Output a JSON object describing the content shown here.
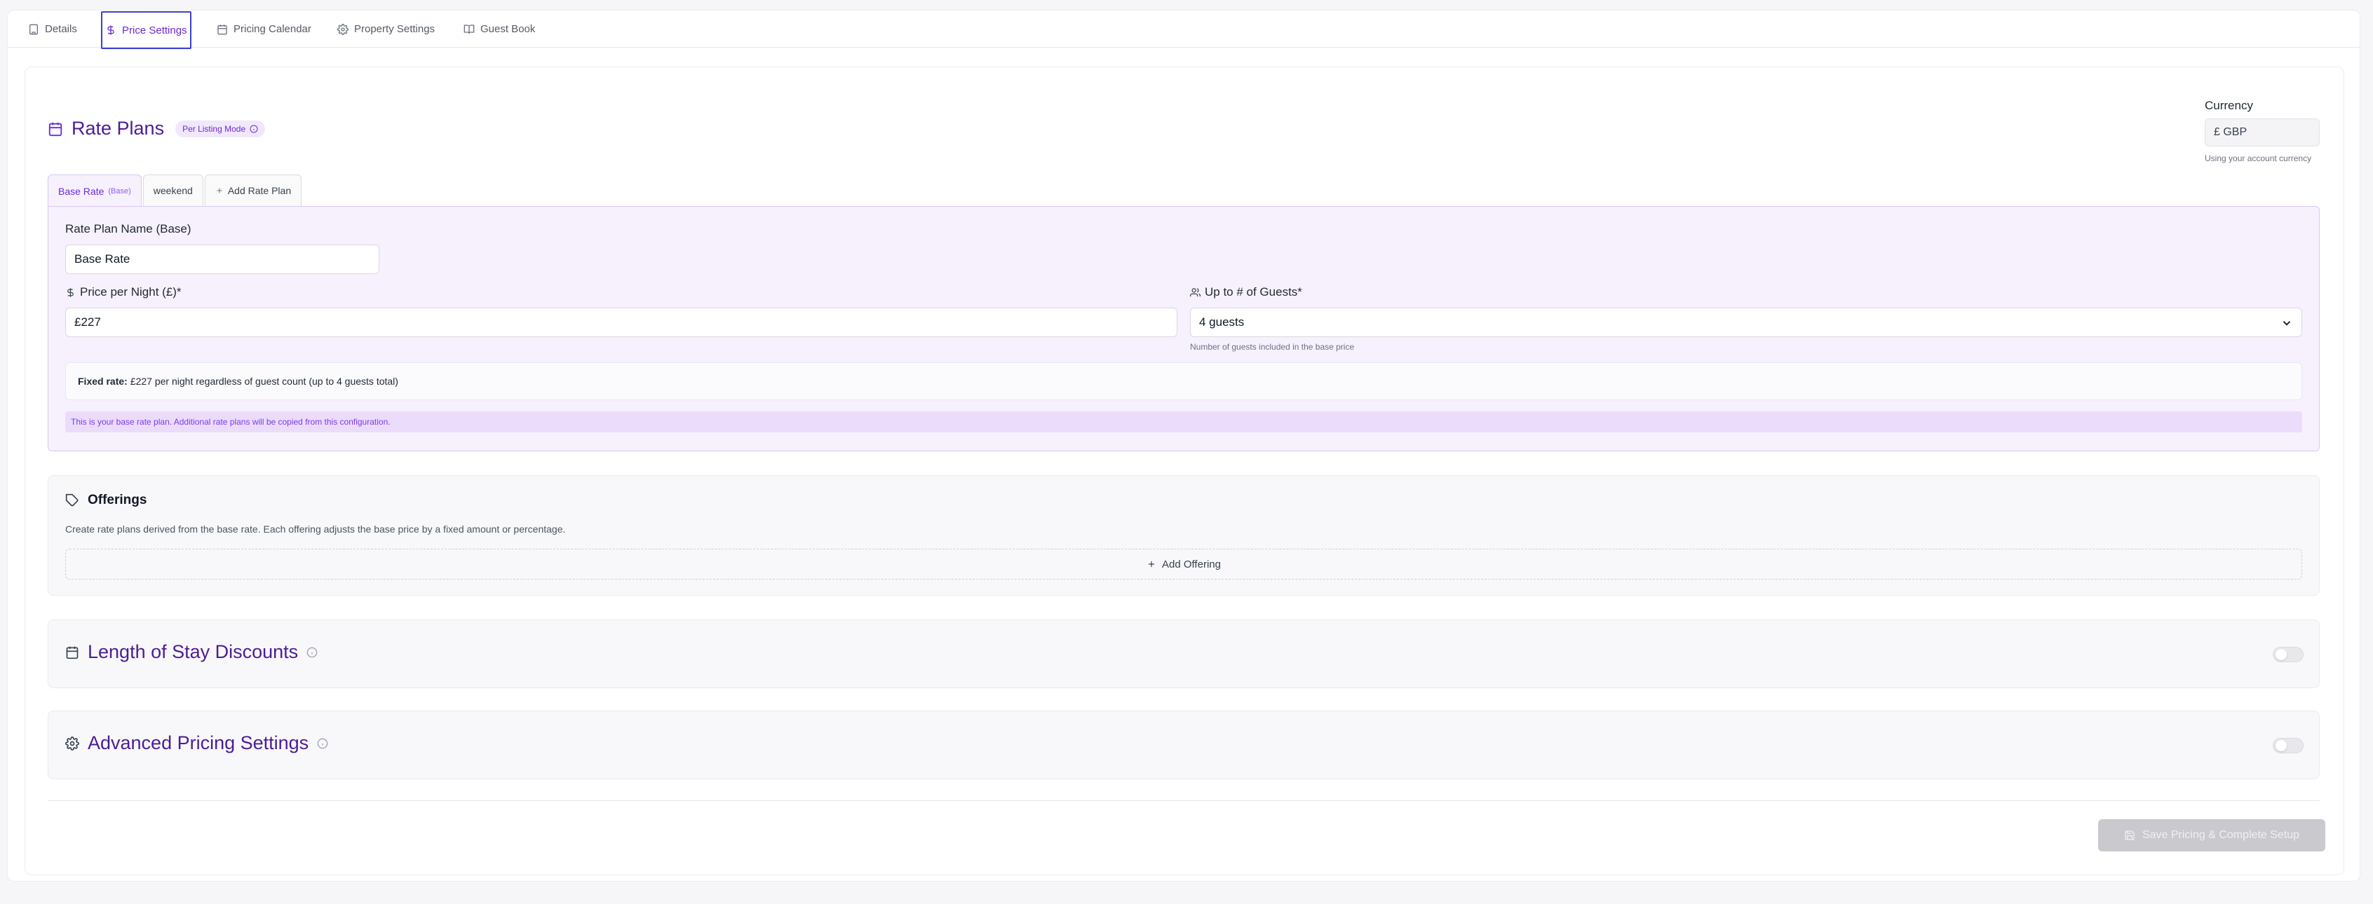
{
  "tabs": [
    {
      "label": "Details",
      "icon": "building-icon"
    },
    {
      "label": "Price Settings",
      "icon": "dollar-icon",
      "active": true
    },
    {
      "label": "Pricing Calendar",
      "icon": "calendar-icon"
    },
    {
      "label": "Property Settings",
      "icon": "gear-icon"
    },
    {
      "label": "Guest Book",
      "icon": "book-icon"
    }
  ],
  "rate_plans": {
    "title": "Rate Plans",
    "mode_badge": "Per Listing Mode",
    "tabs": [
      {
        "label": "Base Rate",
        "sub": "(Base)",
        "active": true
      },
      {
        "label": "weekend"
      },
      {
        "label": "Add Rate Plan"
      }
    ]
  },
  "currency": {
    "label": "Currency",
    "value": "£ GBP",
    "help": "Using your account currency"
  },
  "plan": {
    "name_label": "Rate Plan Name (Base)",
    "name_value": "Base Rate",
    "price_label": "Price per Night (£)*",
    "price_value": "£227",
    "guests_label": "Up to # of Guests*",
    "guests_value": "4 guests",
    "guests_help": "Number of guests included in the base price",
    "fixed_rate_prefix": "Fixed rate:",
    "fixed_rate_text": "£227 per night regardless of guest count (up to 4 guests total)",
    "base_note": "This is your base rate plan. Additional rate plans will be copied from this configuration."
  },
  "offerings": {
    "title": "Offerings",
    "description": "Create rate plans derived from the base rate. Each offering adjusts the base price by a fixed amount or percentage.",
    "add_label": "Add Offering"
  },
  "length_of_stay": {
    "title": "Length of Stay Discounts",
    "enabled": false
  },
  "advanced": {
    "title": "Advanced Pricing Settings",
    "enabled": false
  },
  "save_button": "Save Pricing & Complete Setup",
  "colors": {
    "accent": "#6d28d9",
    "heading": "#4c1d95",
    "panel_bg": "#f7f1fe"
  }
}
